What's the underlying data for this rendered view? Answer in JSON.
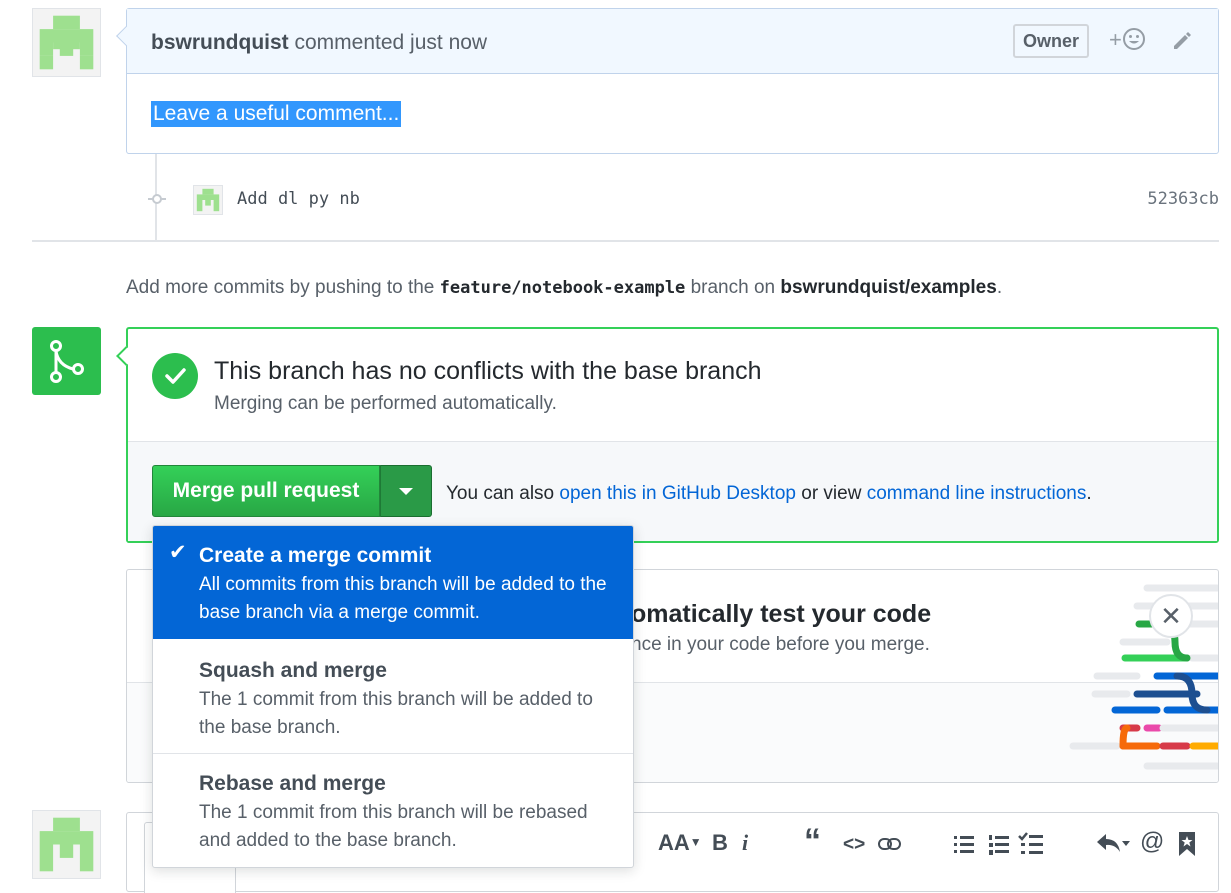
{
  "comment": {
    "author": "bswrundquist",
    "action": " commented just now",
    "badge": "Owner",
    "reaction_label": "+",
    "body": "Leave a useful comment..."
  },
  "commit": {
    "message": "Add dl py nb",
    "sha": "52363cb"
  },
  "push_note": {
    "prefix": "Add more commits by pushing to the ",
    "branch": "feature/notebook-example",
    "middle": " branch on ",
    "repo": "bswrundquist/examples",
    "suffix": "."
  },
  "merge": {
    "title": "This branch has no conflicts with the base branch",
    "subtitle": "Merging can be performed automatically.",
    "button_label": "Merge pull request",
    "also_prefix": "You can also ",
    "link_desktop": "open this in GitHub Desktop",
    "also_middle": " or view ",
    "link_cli": "command line instructions",
    "also_suffix": "."
  },
  "merge_menu": {
    "items": [
      {
        "title": "Create a merge commit",
        "line1": "All commits from this branch will be added to the",
        "line2": "base branch via a merge commit.",
        "selected": true
      },
      {
        "title": "Squash and merge",
        "line1": "The 1 commit from this branch will be added to",
        "line2": "the base branch.",
        "selected": false
      },
      {
        "title": "Rebase and merge",
        "line1": "The 1 commit from this branch will be rebased",
        "line2": "and added to the base branch.",
        "selected": false
      }
    ]
  },
  "ci_promo": {
    "title_fragment": "omatically test your code",
    "subtitle_fragment": "nce in your code before you merge."
  },
  "toolbar": {
    "heading": "AA",
    "bold": "B",
    "italic": "i",
    "quote": "“",
    "code": "<>",
    "at": "@"
  },
  "colors": {
    "accent_blue": "#0366d6",
    "success_green": "#2cbe4e",
    "selection_blue": "#3297fd"
  }
}
